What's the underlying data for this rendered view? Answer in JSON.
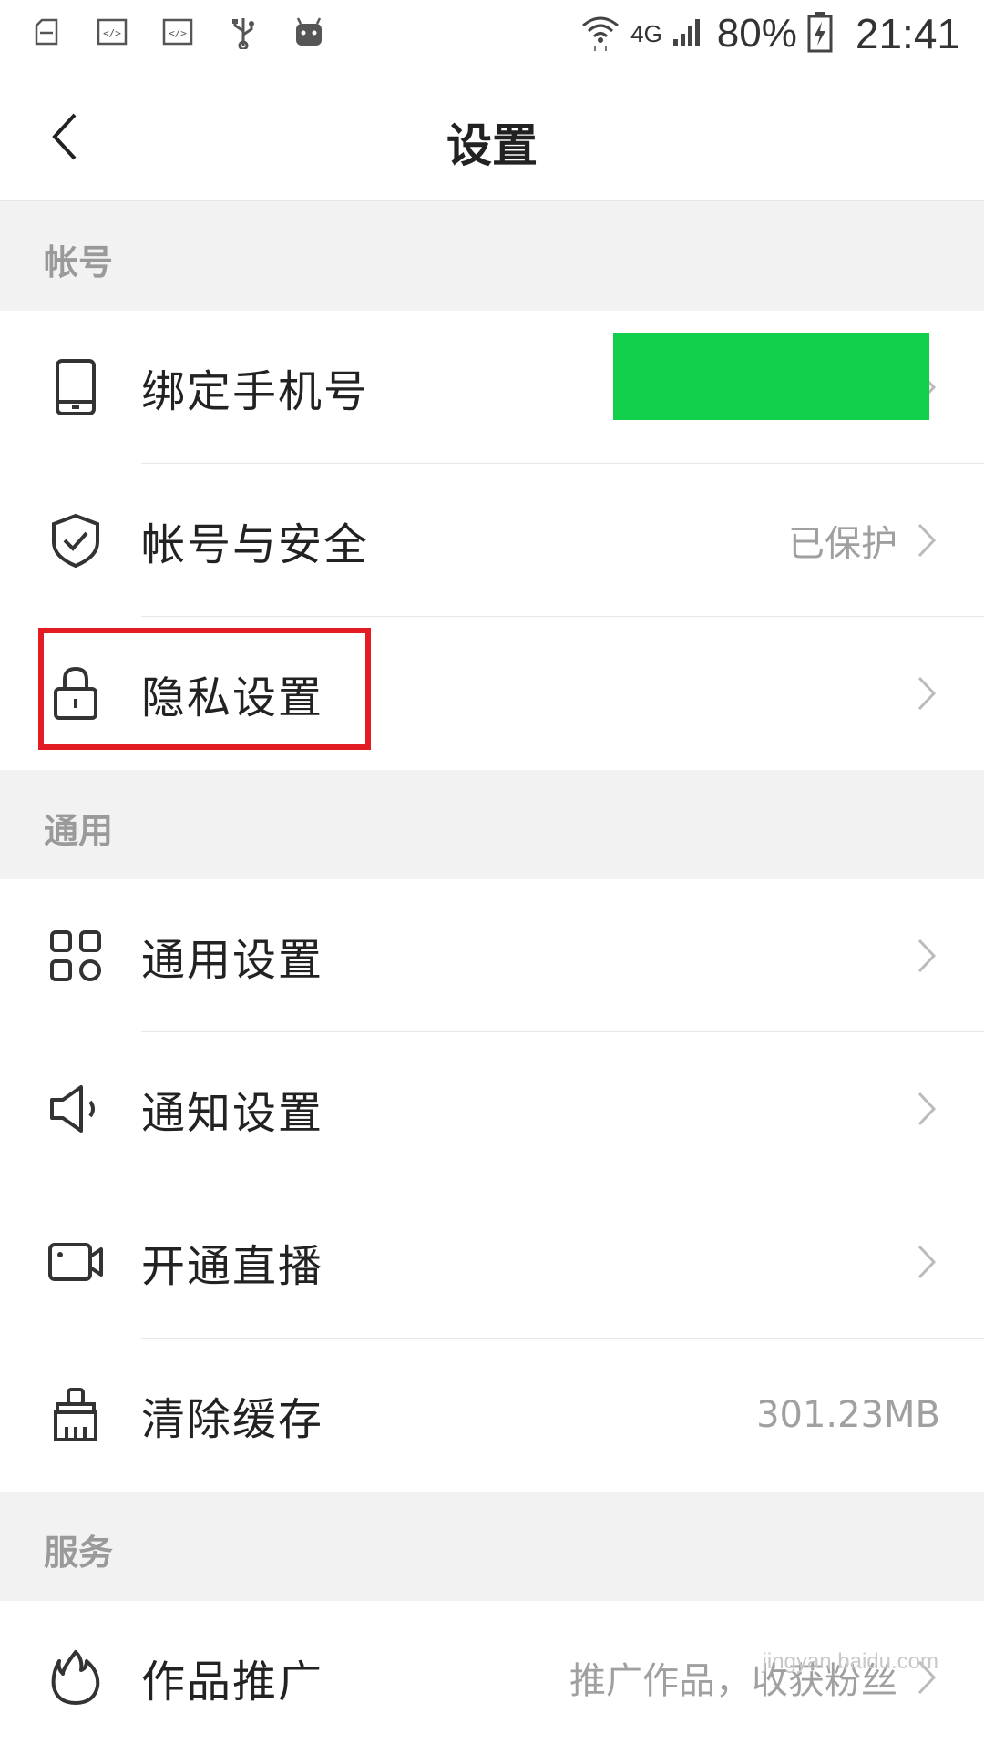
{
  "status_bar": {
    "battery": "80%",
    "time": "21:41",
    "network": "4G",
    "icons_left": [
      "clipboard-icon",
      "code-icon",
      "code-icon",
      "usb-icon",
      "android-icon"
    ]
  },
  "nav": {
    "title": "设置"
  },
  "sections": {
    "account": "帐号",
    "general": "通用",
    "service": "服务"
  },
  "rows": {
    "bind_phone": {
      "label": "绑定手机号",
      "icon": "phone-icon"
    },
    "account_security": {
      "label": "帐号与安全",
      "value": "已保护",
      "icon": "shield-check-icon"
    },
    "privacy": {
      "label": "隐私设置",
      "icon": "lock-icon"
    },
    "general_settings": {
      "label": "通用设置",
      "icon": "grid-icon"
    },
    "notification": {
      "label": "通知设置",
      "icon": "speaker-icon"
    },
    "live": {
      "label": "开通直播",
      "icon": "video-camera-icon"
    },
    "clear_cache": {
      "label": "清除缓存",
      "value": "301.23MB",
      "icon": "broom-icon"
    },
    "promote": {
      "label": "作品推广",
      "value": "推广作品，收获粉丝",
      "icon": "flame-icon"
    }
  },
  "colors": {
    "redaction": "#11cf4a",
    "highlight": "#e31b23",
    "section_bg": "#f2f2f2"
  },
  "watermark": "jingyan.baidu.com"
}
